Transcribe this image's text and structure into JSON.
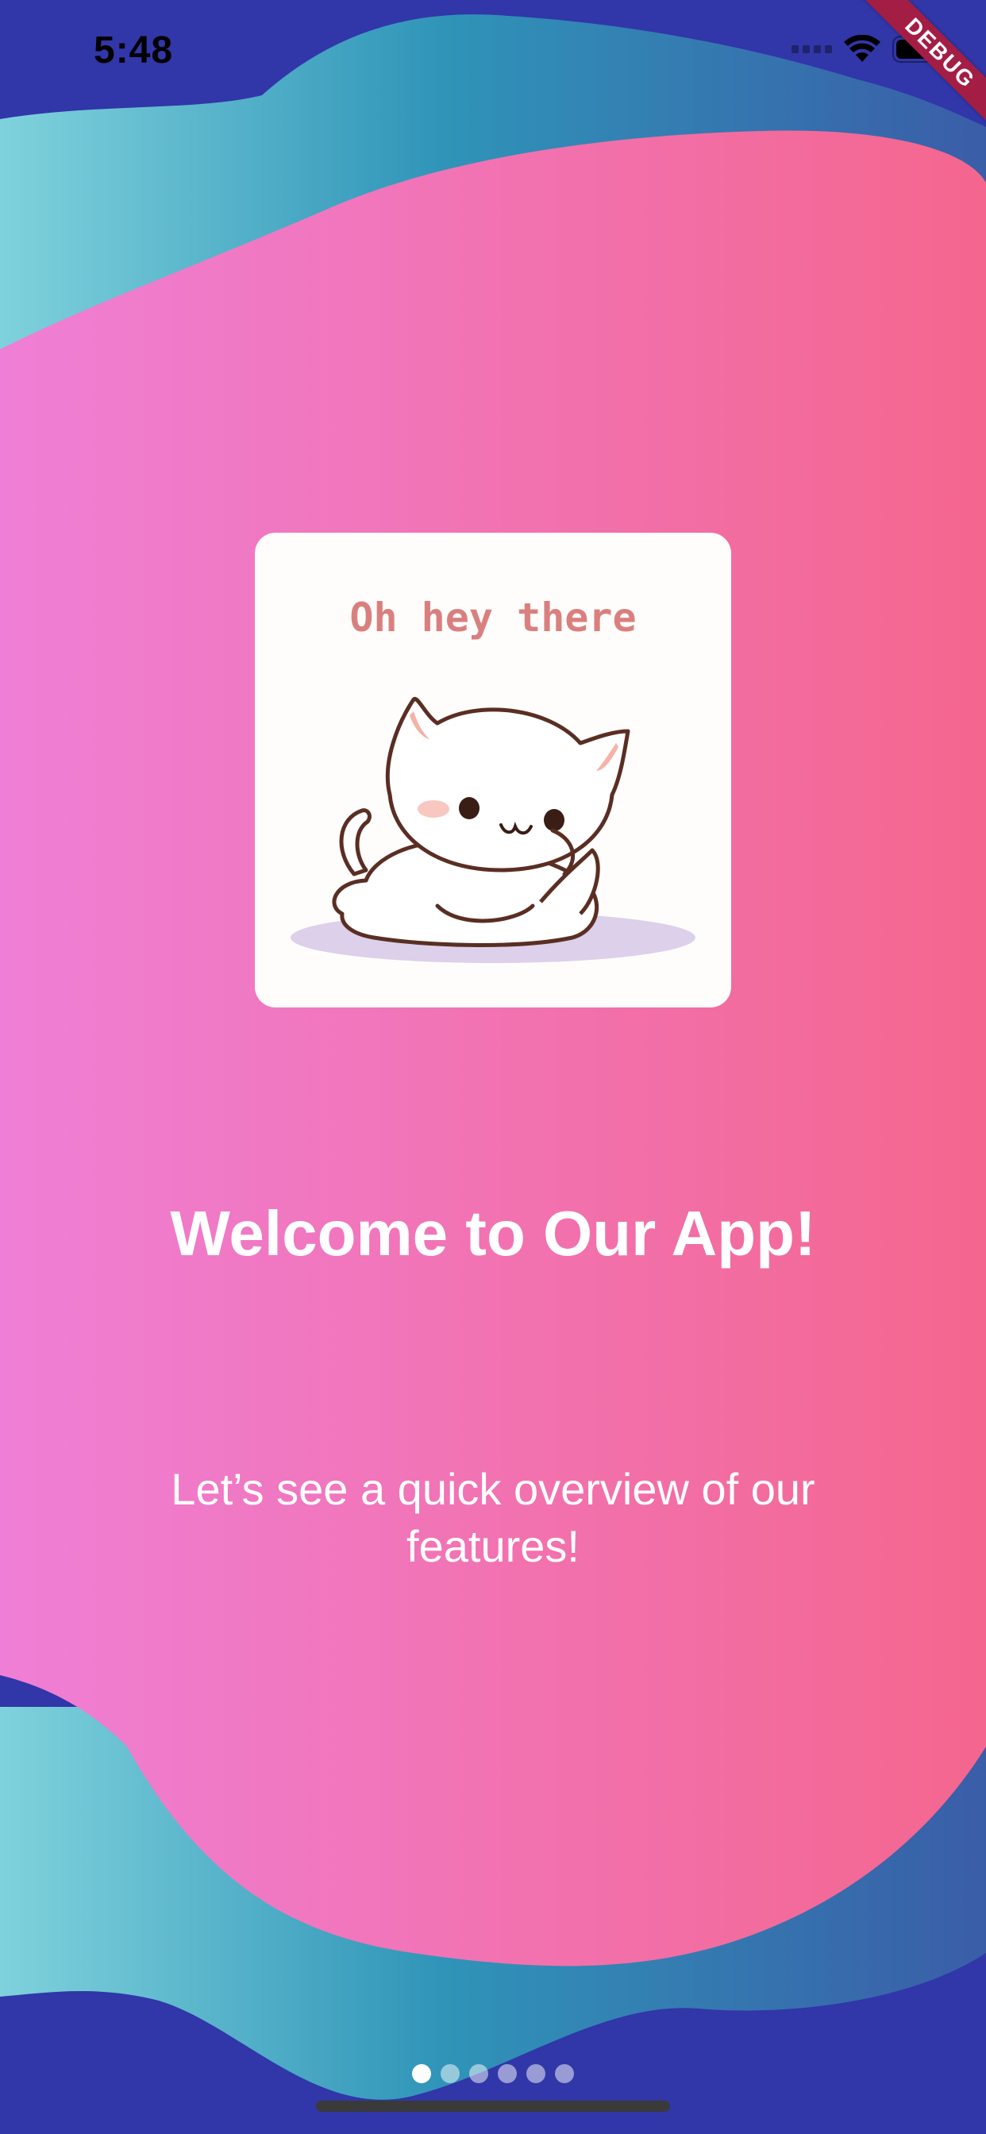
{
  "status_bar": {
    "time": "5:48",
    "icons": [
      "signal-icon",
      "wifi-icon",
      "battery-icon"
    ]
  },
  "debug_banner": "DEBUG",
  "onboarding": {
    "card_caption": "Oh hey there",
    "card_image": "cat-sticker-image",
    "title": "Welcome to Our App!",
    "subtitle": "Let’s see a quick overview of our features!",
    "page_count": 6,
    "active_page": 1
  },
  "colors": {
    "navy": "#3136a8",
    "teal": "#3a8fb2",
    "pink_left": "#ef7fd6",
    "pink_right": "#f4668e",
    "card_caption": "#d9807f"
  }
}
